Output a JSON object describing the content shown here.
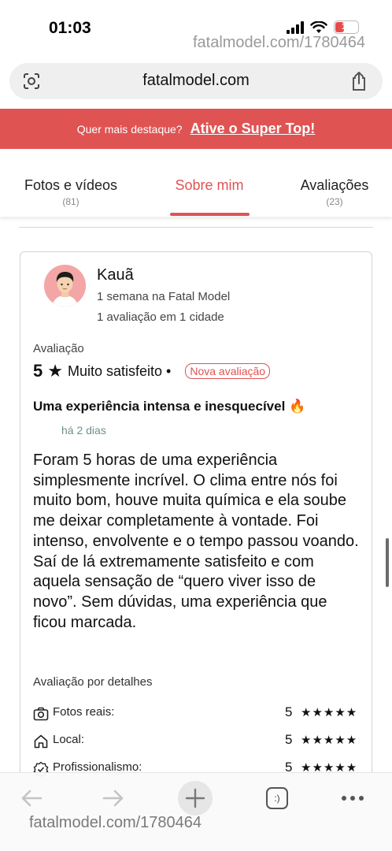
{
  "status_bar": {
    "time": "01:03",
    "battery": "17",
    "watermark": "fatalmodel.com/1780464"
  },
  "url_bar": {
    "domain": "fatalmodel.com"
  },
  "promo": {
    "text": "Quer mais destaque?",
    "link": "Ative o Super Top!"
  },
  "tabs": [
    {
      "label": "Fotos e vídeos",
      "count": "(81)"
    },
    {
      "label": "Sobre mim",
      "count": ""
    },
    {
      "label": "Avaliações",
      "count": "(23)"
    }
  ],
  "review": {
    "user_name": "Kauã",
    "member_since": "1 semana na Fatal Model",
    "review_count": "1 avaliação em 1 cidade",
    "rating_label": "Avaliação",
    "rating_value": "5",
    "rating_text": "Muito satisfeito •",
    "badge": "Nova avaliação",
    "title": "Uma experiência intensa e inesquecível 🔥",
    "date": "há 2 dias",
    "body": "Foram 5 horas de uma experiência simplesmente incrível. O clima entre nós foi muito bom, houve muita química e ela soube me deixar completamente à vontade. Foi intenso, envolvente e o tempo passou voando. Saí de lá extremamente satisfeito e com aquela sensação de “quero viver isso de novo”. Sem dúvidas, uma experiência que ficou marcada.",
    "details_label": "Avaliação por detalhes",
    "details": [
      {
        "label": "Fotos reais:",
        "score": "5",
        "stars": "★★★★★",
        "icon": "camera-check-icon"
      },
      {
        "label": "Local:",
        "score": "5",
        "stars": "★★★★★",
        "icon": "home-icon"
      },
      {
        "label": "Profissionalismo:",
        "score": "5",
        "stars": "★★★★★",
        "icon": "badge-check-icon"
      }
    ]
  },
  "bottom_bar": {
    "watermark": "fatalmodel.com/1780464",
    "tabs_icon_text": ":)"
  },
  "colors": {
    "accent": "#e05353",
    "date_color": "#6f8f8f"
  }
}
